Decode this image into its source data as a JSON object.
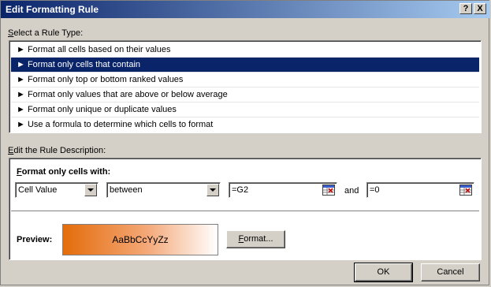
{
  "window": {
    "title": "Edit Formatting Rule",
    "help_glyph": "?",
    "close_glyph": "X"
  },
  "rule_type": {
    "label_prefix": "S",
    "label_rest": "elect a Rule Type:",
    "items": [
      {
        "label": "► Format all cells based on their values"
      },
      {
        "label": "► Format only cells that contain",
        "selected": true
      },
      {
        "label": "► Format only top or bottom ranked values"
      },
      {
        "label": "► Format only values that are above or below average"
      },
      {
        "label": "► Format only unique or duplicate values"
      },
      {
        "label": "► Use a formula to determine which cells to format"
      }
    ]
  },
  "description": {
    "label_prefix": "E",
    "label_rest": "dit the Rule Description:",
    "heading_prefix": "F",
    "heading_rest": "ormat only cells with:",
    "condition_type": "Cell Value",
    "operator": "between",
    "value1": "=G2",
    "and_label": "and",
    "value2": "=0",
    "preview_label": "Preview:",
    "preview_sample": "AaBbCcYyZz",
    "format_button_prefix": "F",
    "format_button_rest": "ormat..."
  },
  "buttons": {
    "ok": "OK",
    "cancel": "Cancel"
  },
  "colors": {
    "title_bar": "#0a246a",
    "selection": "#0a246a",
    "preview_fill": "#e46c0a",
    "dialog_bg": "#d4d0c8"
  }
}
